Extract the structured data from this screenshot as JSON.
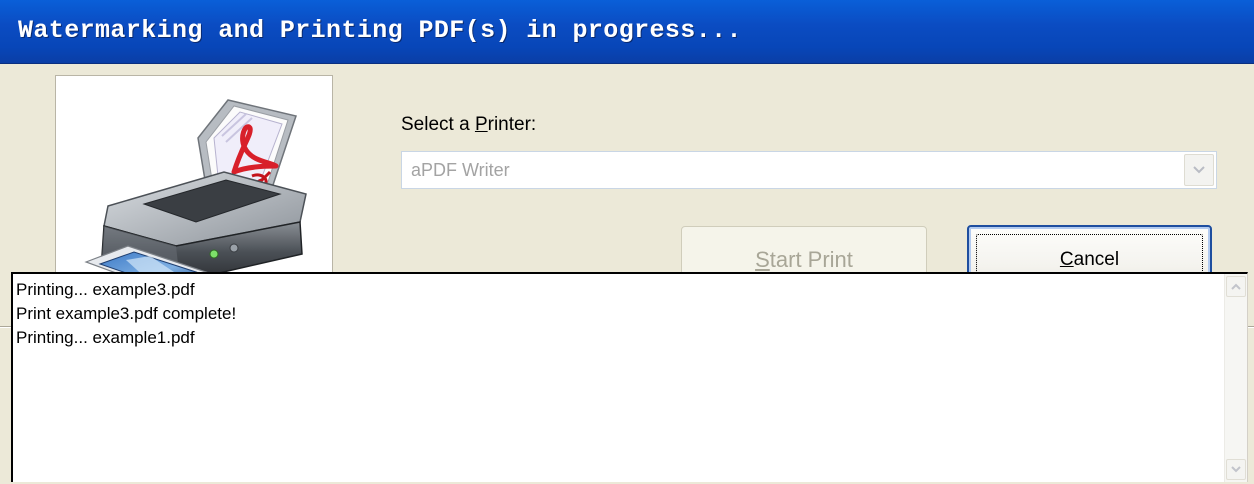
{
  "window": {
    "title": "Watermarking and Printing PDF(s) in progress..."
  },
  "printer": {
    "label_prefix": "Select a ",
    "label_accel": "P",
    "label_rest": "rinter:",
    "selected": "aPDF Writer"
  },
  "buttons": {
    "start_accel": "S",
    "start_rest": "tart Print",
    "cancel_accel": "C",
    "cancel_rest": "ancel"
  },
  "log": {
    "lines": [
      "Printing... example3.pdf",
      "Print example3.pdf complete!",
      "Printing... example1.pdf"
    ]
  },
  "icons": {
    "printer_image": "printer-with-pdf-icon",
    "combo_arrow": "chevron-down-icon",
    "scroll_up": "chevron-up-icon",
    "scroll_down": "chevron-down-icon"
  },
  "colors": {
    "titlebar": "#0b4cc2",
    "dialog_bg": "#ece9d8",
    "disabled_text": "#a8a697",
    "focus_border": "#1e4e9f"
  }
}
